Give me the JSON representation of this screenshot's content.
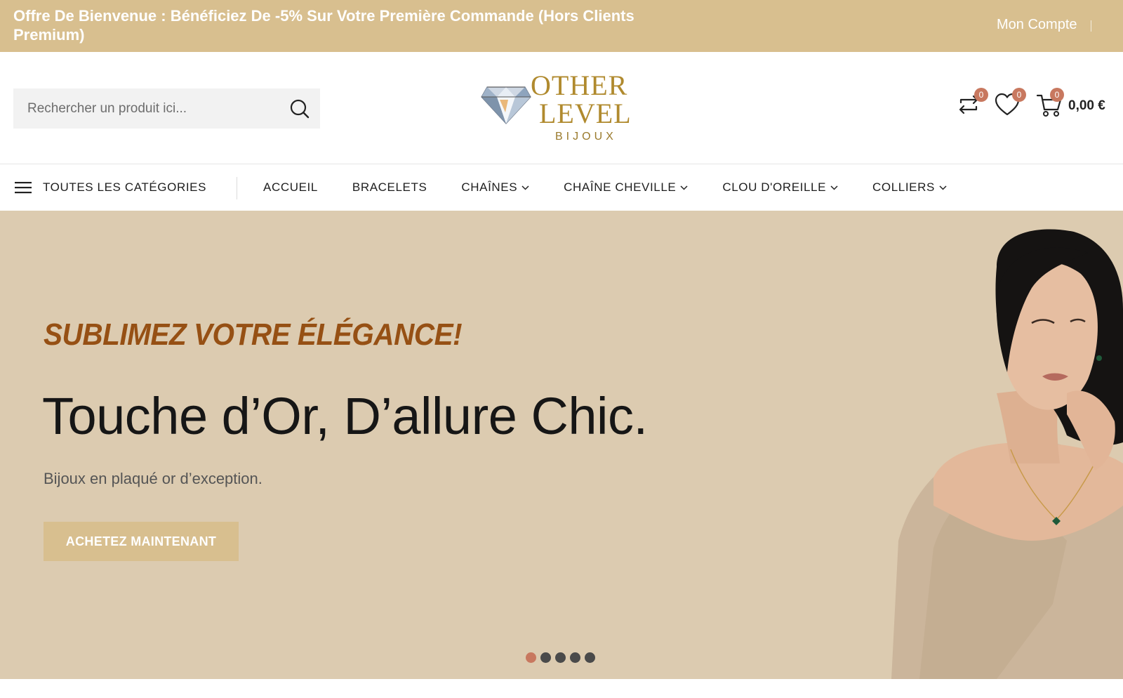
{
  "topbar": {
    "promo": "Offre De Bienvenue : Bénéficiez De -5% Sur Votre Première Commande (Hors Clients Premium)",
    "account": "Mon Compte"
  },
  "header": {
    "search_placeholder": "Rechercher un produit ici...",
    "logo": {
      "line1": "OTHER",
      "line2": "LEVEL",
      "line3": "BIJOUX"
    },
    "compare_count": "0",
    "wishlist_count": "0",
    "cart_count": "0",
    "cart_total": "0,00 €"
  },
  "nav": {
    "all_categories": "TOUTES LES CATÉGORIES",
    "items": [
      {
        "label": "ACCUEIL"
      },
      {
        "label": "BRACELETS"
      },
      {
        "label": "CHAÎNES"
      },
      {
        "label": "CHAÎNE CHEVILLE"
      },
      {
        "label": "CLOU D'OREILLE"
      },
      {
        "label": "COLLIERS"
      }
    ]
  },
  "hero": {
    "kicker": "SUBLIMEZ VOTRE ÉLÉGANCE!",
    "headline": "Touche d’Or, D’allure Chic.",
    "subtitle": "Bijoux en plaqué or d’exception.",
    "cta": "ACHETEZ MAINTENANT",
    "slide_count": 5,
    "active_slide": 1
  },
  "colors": {
    "accent": "#d8bf8f",
    "hero_bg": "#dccbb0",
    "kicker": "#965014",
    "badge": "#c8785f"
  }
}
